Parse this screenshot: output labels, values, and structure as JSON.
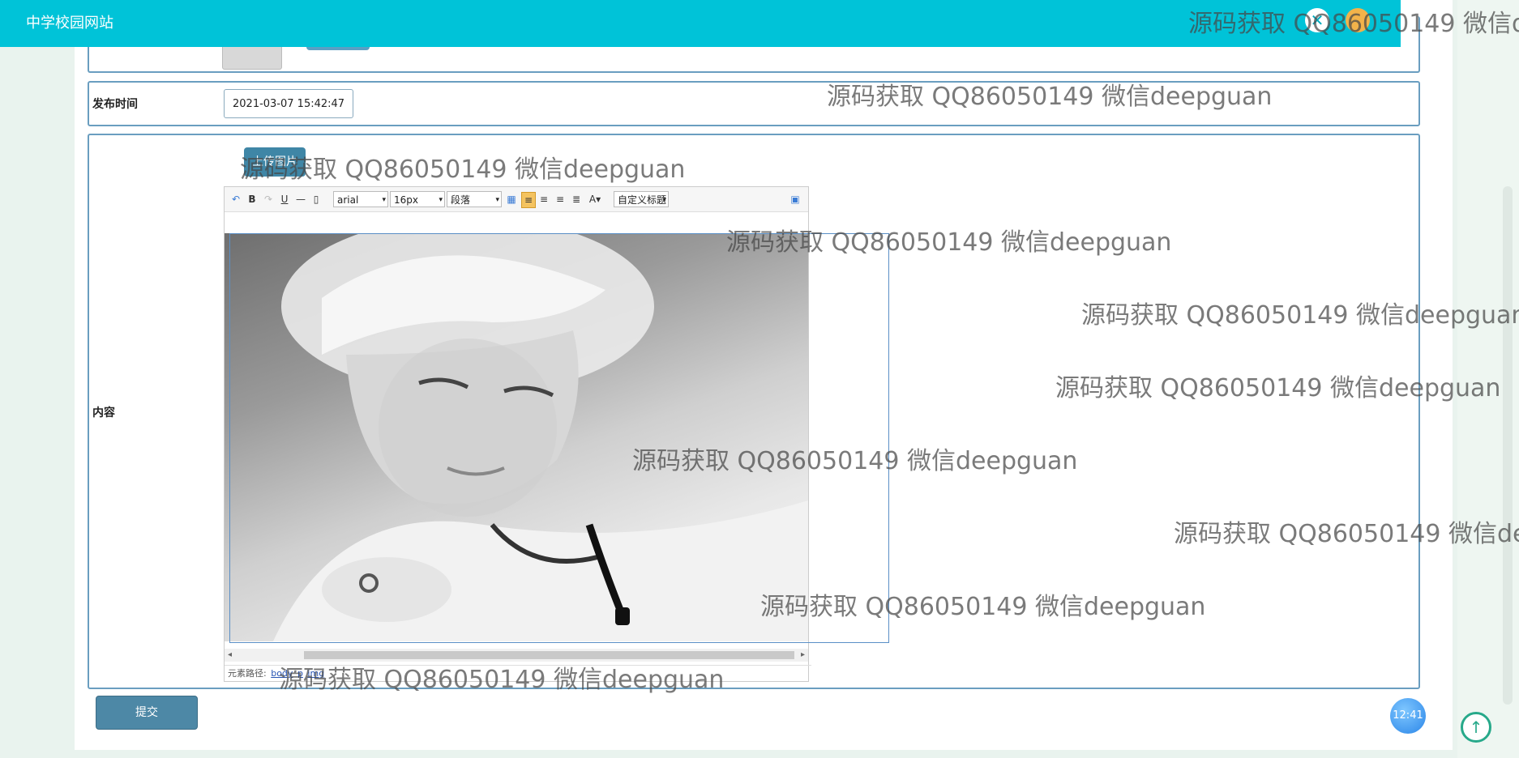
{
  "header": {
    "site_title": "中学校园网站"
  },
  "form": {
    "publish_time_label": "发布时间",
    "publish_time_value": "2021-03-07 15:42:47",
    "content_label": "内容",
    "upload_button": "上传图片",
    "submit_button": "提交"
  },
  "editor": {
    "font_family": "arial",
    "font_size": "16px",
    "paragraph": "段落",
    "custom_title": "自定义标题",
    "path_label": "元素路径:",
    "path_items": [
      "body",
      "p",
      "img"
    ]
  },
  "status": {
    "clock": "12:41"
  },
  "watermark": "源码获取 QQ86050149 微信deepguan",
  "icons": [
    "close-icon",
    "user-avatar",
    "undo-icon",
    "bold-icon",
    "redo-icon",
    "underline-icon",
    "horizontal-rule-icon",
    "paste-icon",
    "table-icon",
    "align-left-icon",
    "align-center-icon",
    "align-right-icon",
    "justify-icon",
    "font-color-icon",
    "fullscreen-icon",
    "back-to-top-icon"
  ]
}
